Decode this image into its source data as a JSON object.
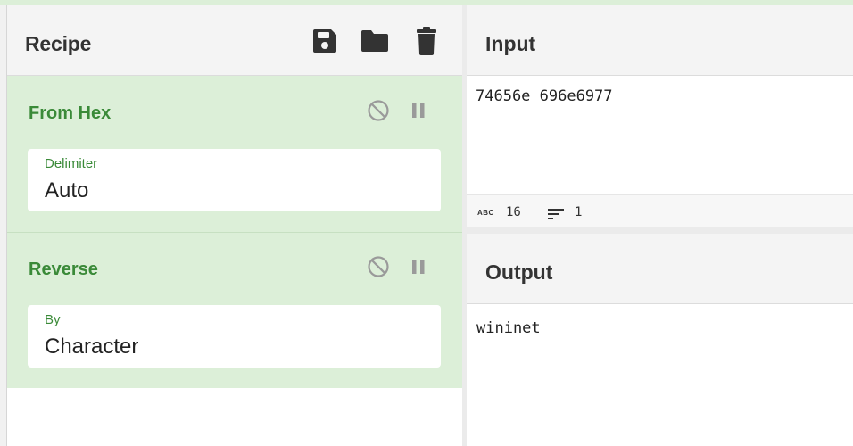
{
  "recipe": {
    "title": "Recipe",
    "icons": [
      "save-icon",
      "folder-icon",
      "trash-icon"
    ],
    "operations": [
      {
        "name": "From Hex",
        "argument_label": "Delimiter",
        "argument_value": "Auto"
      },
      {
        "name": "Reverse",
        "argument_label": "By",
        "argument_value": "Character"
      }
    ]
  },
  "input": {
    "title": "Input",
    "text": "74656e 696e6977",
    "status": {
      "abc_label": "ABC",
      "length": "16",
      "lines": "1"
    }
  },
  "output": {
    "title": "Output",
    "text": "wininet"
  },
  "colors": {
    "operation_bg": "#dcefd8",
    "operation_title": "#3a8a38",
    "header_bg": "#f4f4f4"
  }
}
